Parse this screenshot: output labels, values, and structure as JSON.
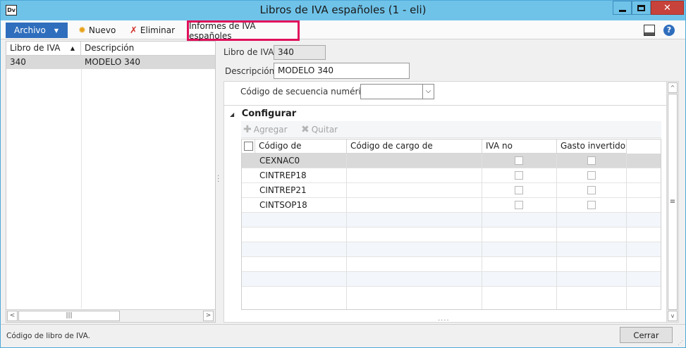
{
  "window": {
    "title": "Libros de IVA españoles (1 - eli)",
    "app_icon": "Dv"
  },
  "ribbon": {
    "archivo_label": "Archivo",
    "nuevo_label": "Nuevo",
    "eliminar_label": "Eliminar",
    "informes_label": "Informes de IVA españoles",
    "help_icon": "?"
  },
  "list": {
    "columns": [
      "Libro de IVA",
      "Descripción"
    ],
    "rows": [
      {
        "libro": "340",
        "descripcion": "MODELO 340"
      }
    ]
  },
  "form": {
    "libro_label": "Libro de IVA:",
    "libro_value": "340",
    "descripcion_label": "Descripción:",
    "descripcion_value": "MODELO 340",
    "secuencia_label": "Código de secuencia numérica:",
    "secuencia_value": ""
  },
  "configurar": {
    "title": "Configurar",
    "agregar_label": "Agregar",
    "quitar_label": "Quitar",
    "columns": [
      "Código de impuestos",
      "Código de cargo de equivalencia",
      "IVA no deducible",
      "Gasto invertido"
    ],
    "rows": [
      {
        "codigo": "CEXNAC0",
        "cargo": "",
        "iva_no_deducible": false,
        "gasto_invertido": false
      },
      {
        "codigo": "CINTREP18",
        "cargo": "",
        "iva_no_deducible": false,
        "gasto_invertido": false
      },
      {
        "codigo": "CINTREP21",
        "cargo": "",
        "iva_no_deducible": false,
        "gasto_invertido": false
      },
      {
        "codigo": "CINTSOP18",
        "cargo": "",
        "iva_no_deducible": false,
        "gasto_invertido": false
      }
    ]
  },
  "status": {
    "text": "Código de libro de IVA.",
    "cerrar_label": "Cerrar"
  },
  "colors": {
    "titlebar": "#6fc3e9",
    "archivo": "#2f6ebd",
    "highlight": "#e0105b",
    "close": "#c7423a"
  }
}
